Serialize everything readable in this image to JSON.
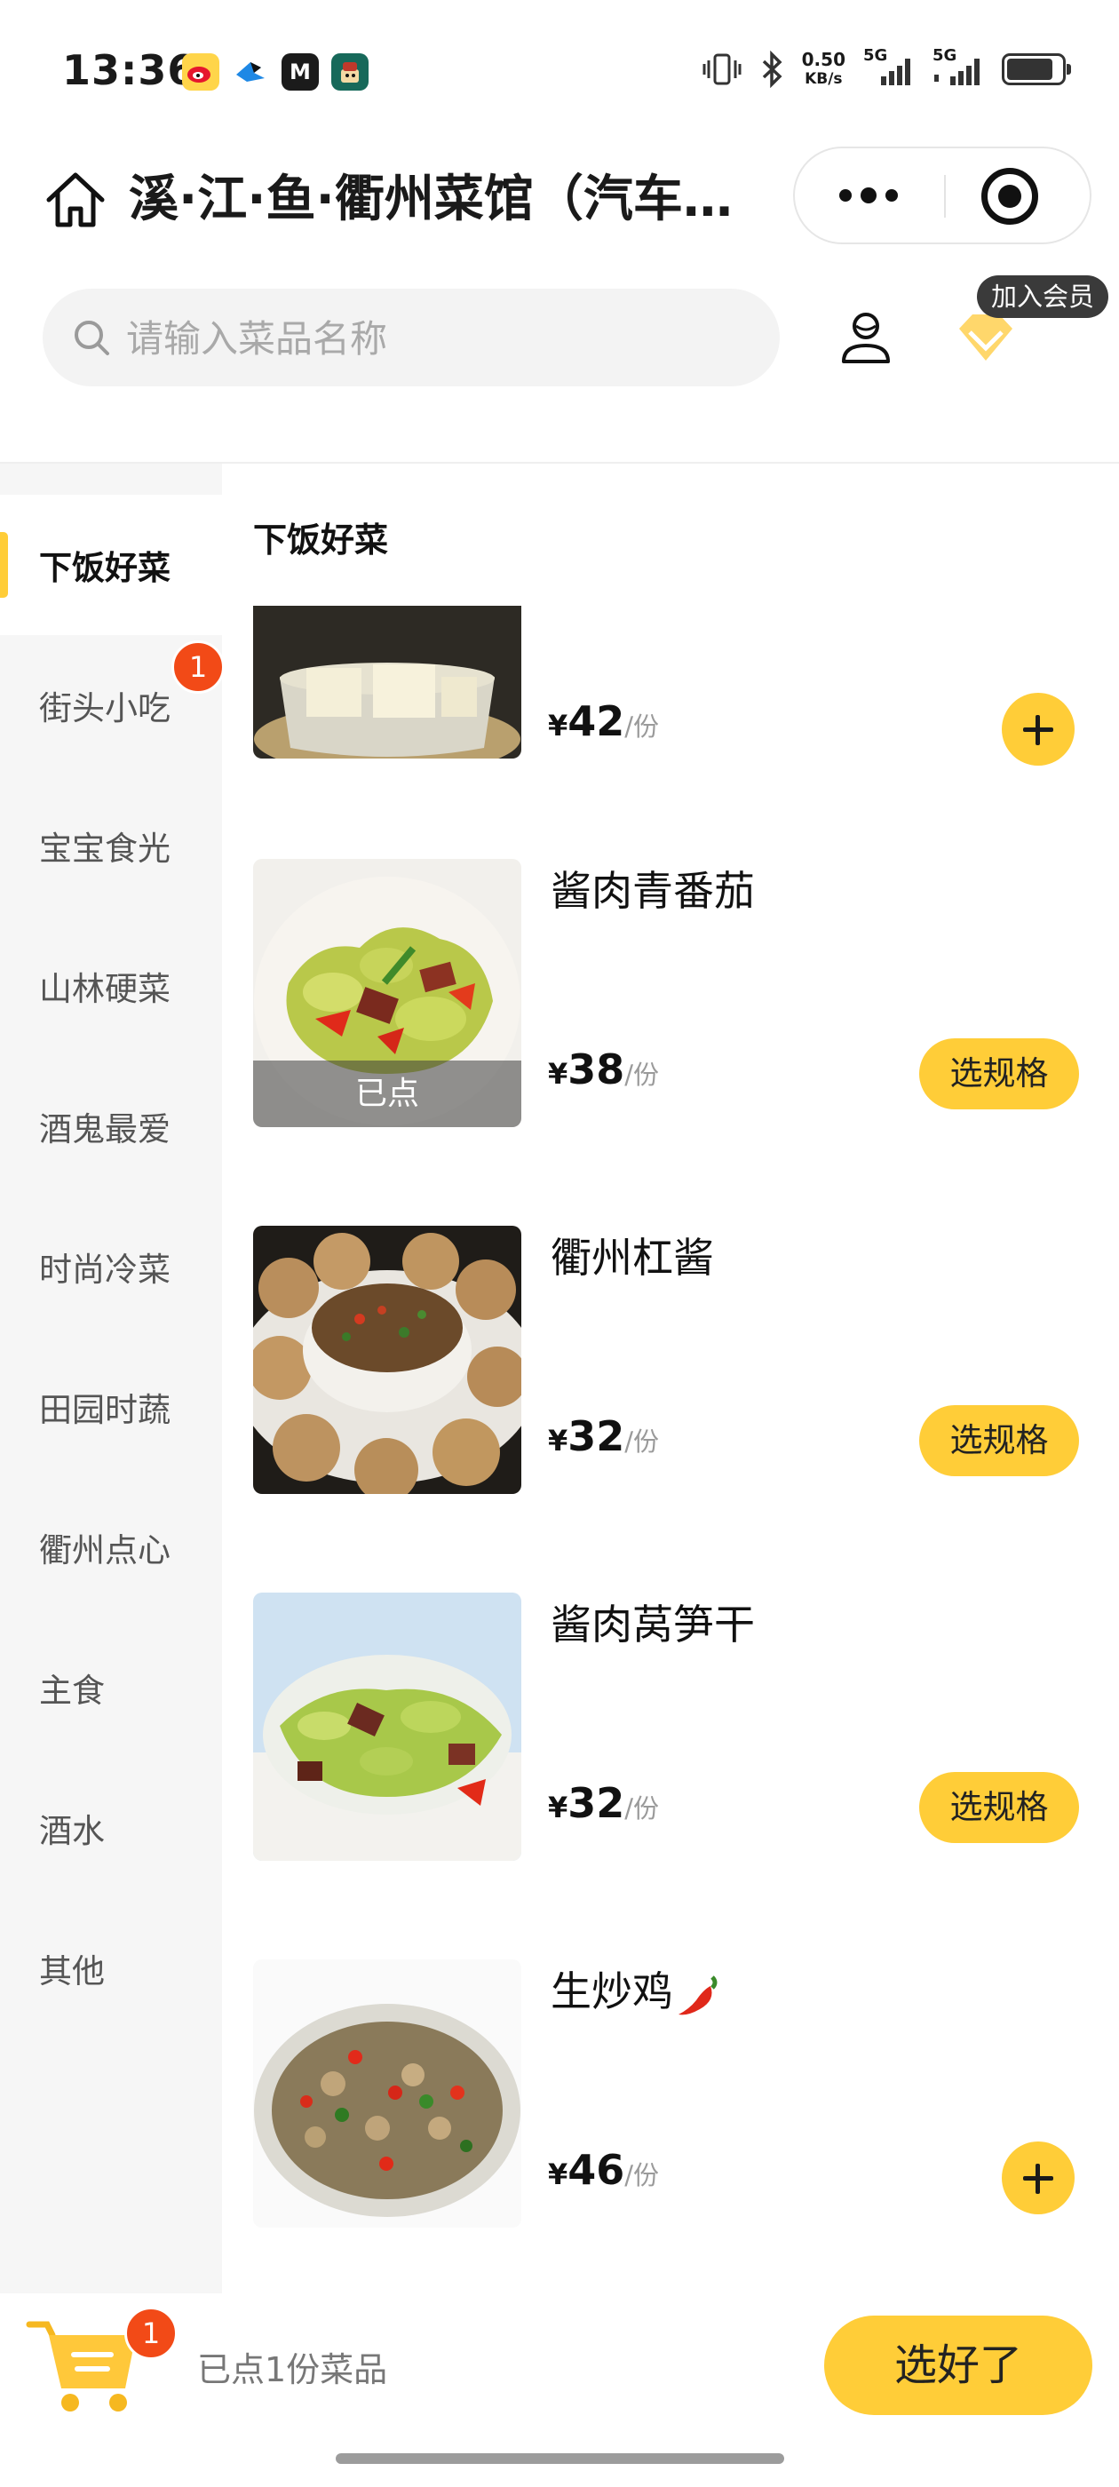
{
  "status_bar": {
    "time": "13:36",
    "net_speed_value": "0.50",
    "net_speed_unit": "KB/s",
    "signal_1": "5G",
    "signal_2": "5G",
    "battery_level": 0.85,
    "app_icons": [
      "weibo-icon",
      "bird-app-icon",
      "m-app-icon",
      "avatar-app-icon"
    ],
    "m_icon_letter": "M"
  },
  "header": {
    "title": "溪·江·鱼·衢州菜馆（汽车…"
  },
  "search": {
    "placeholder": "请输入菜品名称"
  },
  "member_badge": "加入会员",
  "sidebar": {
    "items": [
      {
        "label": "下饭好菜",
        "active": true
      },
      {
        "label": "街头小吃",
        "badge": "1"
      },
      {
        "label": "宝宝食光"
      },
      {
        "label": "山林硬菜"
      },
      {
        "label": "酒鬼最爱"
      },
      {
        "label": "时尚冷菜"
      },
      {
        "label": "田园时蔬"
      },
      {
        "label": "衢州点心"
      },
      {
        "label": "主食"
      },
      {
        "label": "酒水"
      },
      {
        "label": "其他"
      }
    ]
  },
  "main": {
    "section_title": "下饭好菜",
    "currency": "¥",
    "unit": "/份",
    "dishes": [
      {
        "name": "",
        "price": "42",
        "action": "add"
      },
      {
        "name": "酱肉青番茄",
        "price": "38",
        "action": "spec",
        "ordered_label": "已点"
      },
      {
        "name": "衢州杠酱",
        "price": "32",
        "action": "spec"
      },
      {
        "name": "酱肉莴笋干",
        "price": "32",
        "action": "spec"
      },
      {
        "name": "生炒鸡",
        "price": "46",
        "action": "add"
      }
    ],
    "spec_label": "选规格"
  },
  "cart": {
    "badge": "1",
    "summary": "已点1份菜品",
    "checkout_label": "选好了"
  },
  "colors": {
    "accent_yellow": "#ffcd38",
    "badge_red": "#f24a17",
    "sidebar_bg": "#f6f6f6"
  }
}
